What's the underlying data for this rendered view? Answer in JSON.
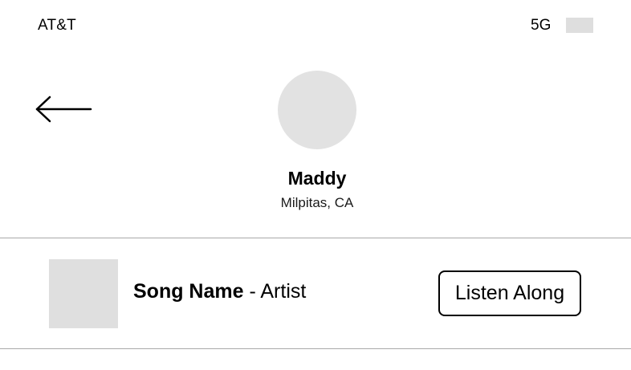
{
  "status_bar": {
    "carrier": "AT&T",
    "network": "5G",
    "battery_icon": "battery-icon"
  },
  "navigation": {
    "back_icon": "arrow-left-icon"
  },
  "profile": {
    "avatar_icon": "avatar-placeholder",
    "name": "Maddy",
    "location": "Milpitas, CA"
  },
  "now_playing": {
    "album_art_icon": "album-art-placeholder",
    "song_name": "Song Name",
    "separator": " - ",
    "artist": "Artist",
    "listen_button_label": "Listen Along"
  },
  "colors": {
    "placeholder_gray": "#e2e2e2",
    "divider": "#a9a9a9",
    "text": "#000000",
    "background": "#ffffff"
  }
}
